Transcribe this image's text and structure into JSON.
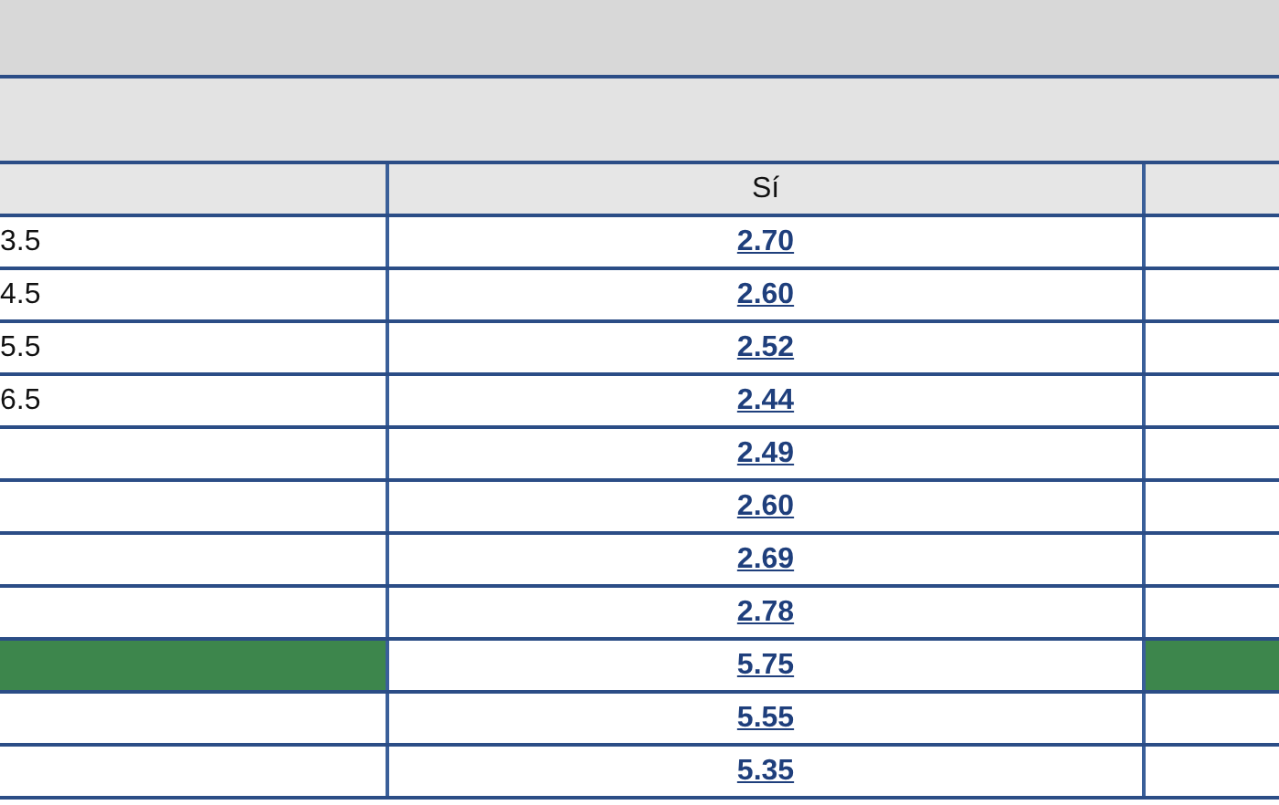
{
  "table": {
    "header": "Sí",
    "rows": [
      {
        "label": "3.5",
        "odds": "2.70",
        "highlighted": false
      },
      {
        "label": "4.5",
        "odds": "2.60",
        "highlighted": false
      },
      {
        "label": "5.5",
        "odds": "2.52",
        "highlighted": false
      },
      {
        "label": "6.5",
        "odds": "2.44",
        "highlighted": false
      },
      {
        "odds": "2.49",
        "highlighted": false
      },
      {
        "odds": "2.60",
        "highlighted": false
      },
      {
        "odds": "2.69",
        "highlighted": false
      },
      {
        "odds": "2.78",
        "highlighted": false
      },
      {
        "odds": "5.75",
        "highlighted": true
      },
      {
        "odds": "5.55",
        "highlighted": false
      },
      {
        "odds": "5.35",
        "highlighted": false
      }
    ]
  }
}
